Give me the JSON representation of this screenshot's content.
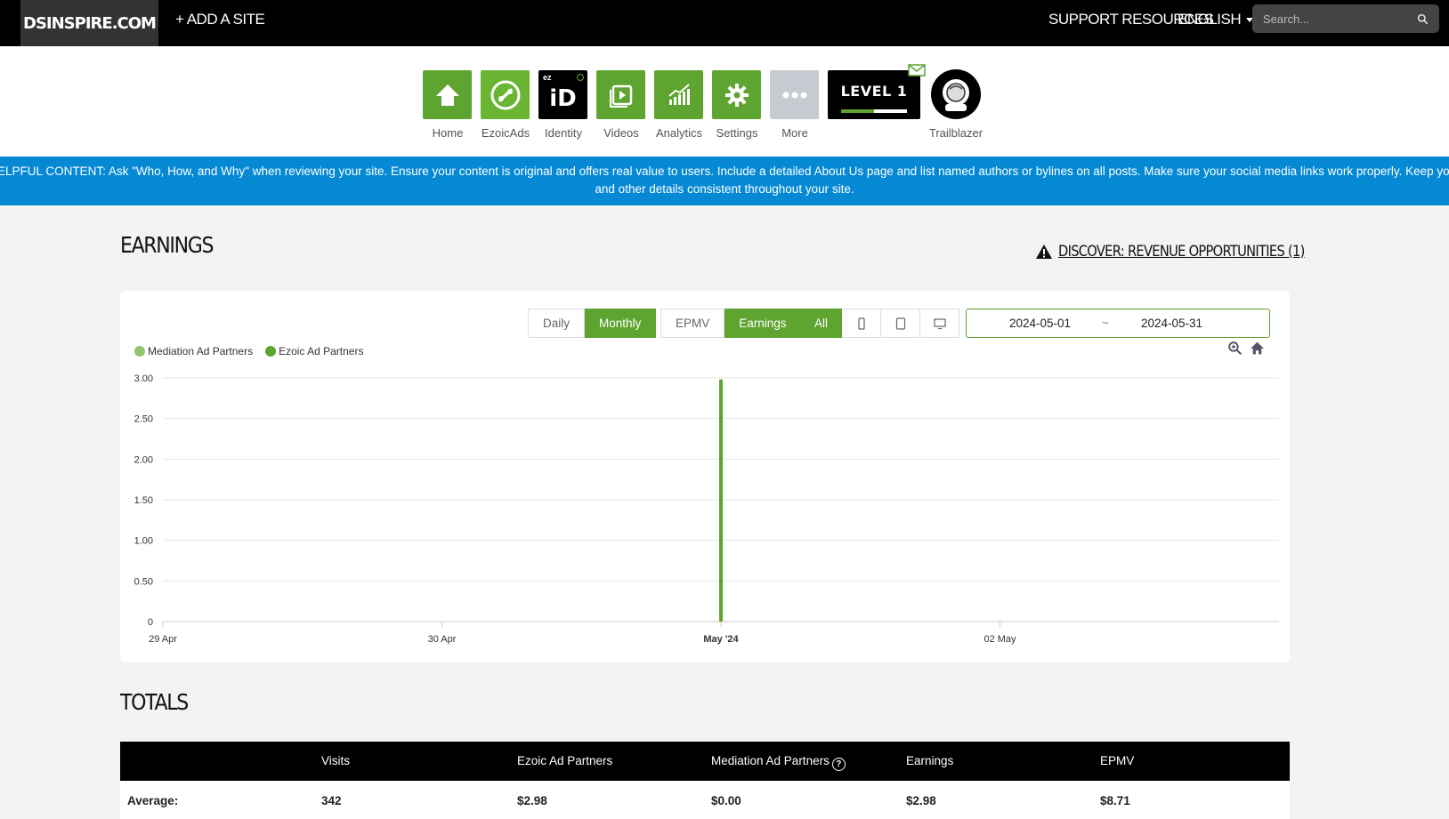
{
  "topbar": {
    "brand": "DSINSPIRE.COM",
    "add_site": "+ ADD A SITE",
    "support": "SUPPORT RESOURCES",
    "language": "ENGLISH",
    "search_placeholder": "Search..."
  },
  "nav": {
    "items": [
      {
        "label": "Home",
        "icon": "home-icon"
      },
      {
        "label": "EzoicAds",
        "icon": "ezoicads-icon"
      },
      {
        "label": "Identity",
        "icon": "identity-icon"
      },
      {
        "label": "Videos",
        "icon": "videos-icon"
      },
      {
        "label": "Analytics",
        "icon": "analytics-icon"
      },
      {
        "label": "Settings",
        "icon": "gear-icon"
      },
      {
        "label": "More",
        "icon": "more-icon"
      }
    ],
    "identity_badge": "ez",
    "identity_text": "iD",
    "level_label": "LEVEL 1",
    "level_progress": 0.5,
    "trailblazer_label": "Trailblazer"
  },
  "banner": {
    "line1": "HELPFUL CONTENT: Ask \"Who, How, and Why\" when reviewing your site. Ensure your content is original and offers real value to users. Include a detailed About Us page and list named authors or bylines on all posts. Make sure your social media links work properly. Keep your",
    "line2": "and other details consistent throughout your site."
  },
  "earnings": {
    "title": "EARNINGS",
    "discover_link": "DISCOVER: REVENUE OPPORTUNITIES (1)",
    "period_buttons": [
      "Daily",
      "Monthly"
    ],
    "period_active": "Monthly",
    "metric_buttons": [
      "EPMV",
      "Earnings"
    ],
    "metric_active": "Earnings",
    "device_all": "All",
    "date_start": "2024-05-01",
    "date_sep": "~",
    "date_end": "2024-05-31"
  },
  "colors": {
    "accent": "#5ea430",
    "mediation": "#92c46f",
    "ezoic": "#5ea430",
    "banner": "#0589d5"
  },
  "chart_data": {
    "type": "bar",
    "legend": [
      "Mediation Ad Partners",
      "Ezoic Ad Partners"
    ],
    "legend_position": "top-left",
    "x_ticks": [
      "29 Apr",
      "30 Apr",
      "May '24",
      "02 May"
    ],
    "y_ticks": [
      "0",
      "0.50",
      "1.00",
      "1.50",
      "2.00",
      "2.50",
      "3.00"
    ],
    "ylim": [
      0,
      3
    ],
    "grid": true,
    "series": [
      {
        "name": "Mediation Ad Partners",
        "color": "#92c46f",
        "points": [
          {
            "x": "May '24",
            "y": 0
          }
        ]
      },
      {
        "name": "Ezoic Ad Partners",
        "color": "#5ea430",
        "points": [
          {
            "x": "May '24",
            "y": 2.98
          }
        ]
      }
    ]
  },
  "totals": {
    "title": "TOTALS",
    "headers": [
      "",
      "Visits",
      "Ezoic Ad Partners",
      "Mediation Ad Partners",
      "Earnings",
      "EPMV"
    ],
    "rows": [
      [
        "Average:",
        "342",
        "$2.98",
        "$0.00",
        "$2.98",
        "$8.71"
      ]
    ]
  }
}
